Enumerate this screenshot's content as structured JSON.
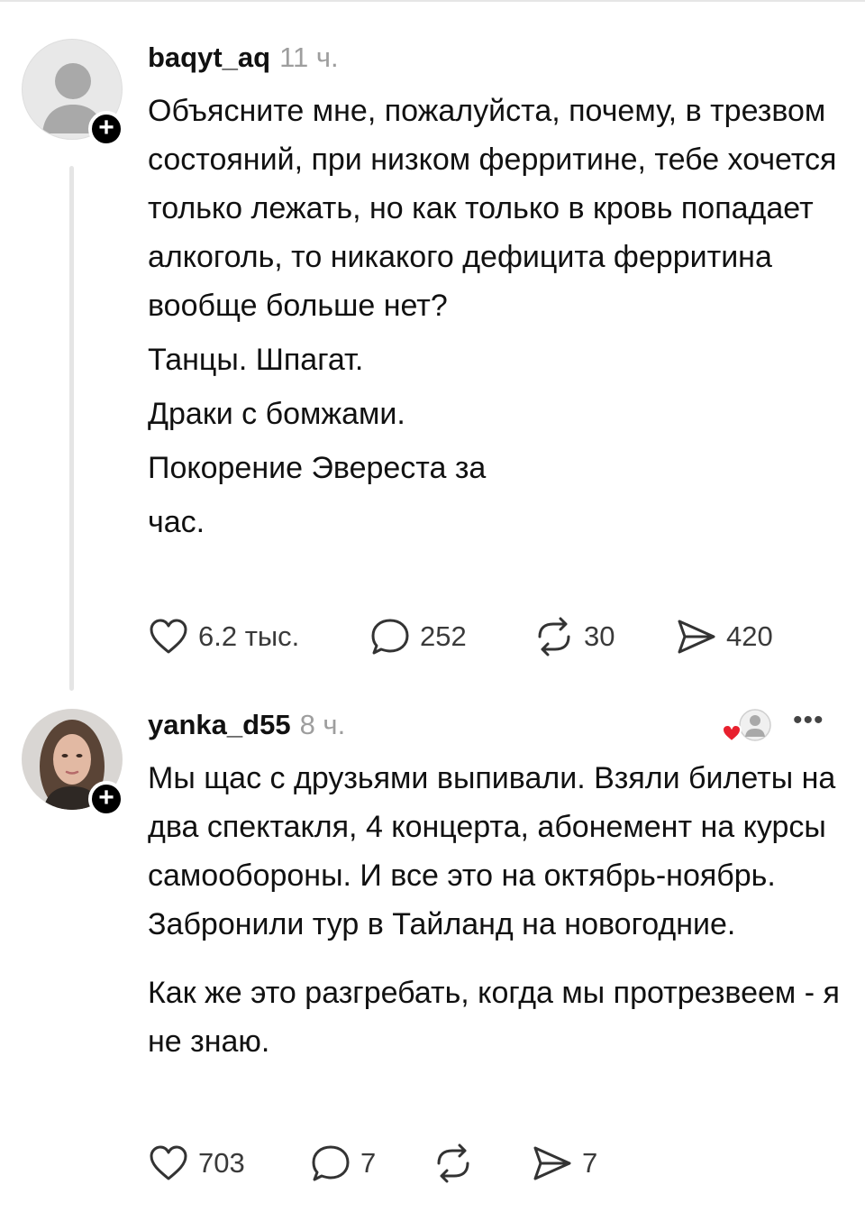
{
  "posts": [
    {
      "username": "baqyt_aq",
      "time": "11 ч.",
      "paragraphs": [
        "Объясните мне, пожалуйста, почему, в трезвом состояний, при низком ферритине, тебе хочется только лежать, но как только в кровь попадает алкоголь, то никакого дефицита ферритина вообще больше нет?",
        "Танцы. Шпагат.",
        "Драки с бомжами.",
        "Покорение Эвереста за",
        "час."
      ],
      "likes": "6.2 тыс.",
      "comments": "252",
      "reposts": "30",
      "shares": "420"
    },
    {
      "username": "yanka_d55",
      "time": "8 ч.",
      "paragraphs": [
        "Мы щас с друзьями выпивали. Взяли билеты на два спектакля, 4 концерта, абонемент на курсы самообороны. И все это на октябрь-ноябрь. Забронили тур в Тайланд на новогодние.",
        "Как же это разгребать, когда мы протрезвеем - я не знаю."
      ],
      "likes": "703",
      "comments": "7",
      "reposts": "",
      "shares": "7"
    }
  ],
  "icons": {
    "follow": "plus-icon",
    "like": "heart-icon",
    "comment": "speech-bubble-icon",
    "repost": "repost-arrows-icon",
    "share": "paper-plane-icon",
    "liked_by_author": "heart-avatar-icon",
    "more": "more-dots-icon"
  },
  "colors": {
    "text": "#111111",
    "muted": "#9e9e9e",
    "accent_heart": "#e8202e"
  }
}
